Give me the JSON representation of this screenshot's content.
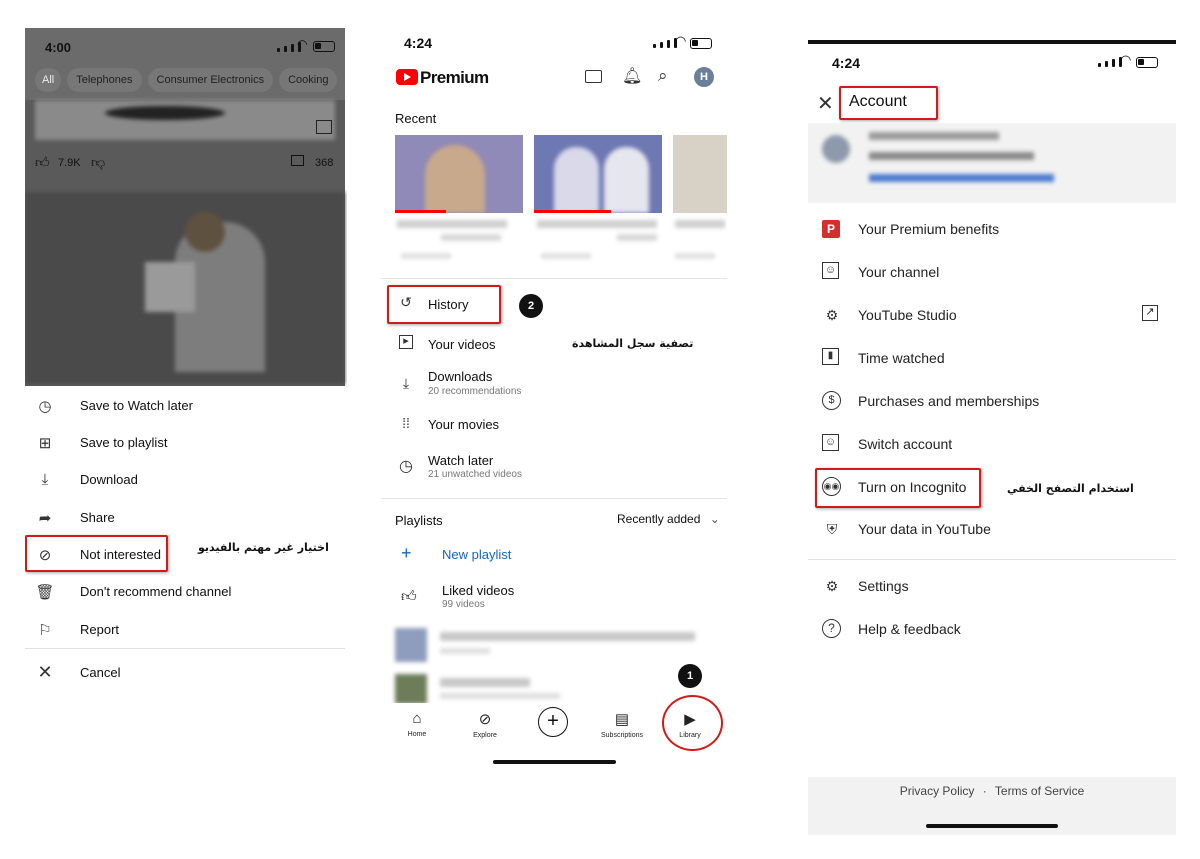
{
  "panel1": {
    "status_time": "4:00",
    "chips": [
      "All",
      "Telephones",
      "Consumer Electronics",
      "Cooking"
    ],
    "likes": "7.9K",
    "comments": "368",
    "menu": [
      {
        "label": "Save to Watch later",
        "icon": "clock-icon"
      },
      {
        "label": "Save to playlist",
        "icon": "playlist-add-icon"
      },
      {
        "label": "Download",
        "icon": "download-icon"
      },
      {
        "label": "Share",
        "icon": "share-icon"
      },
      {
        "label": "Not interested",
        "icon": "not-interested-icon"
      },
      {
        "label": "Don't recommend channel",
        "icon": "trash-icon"
      },
      {
        "label": "Report",
        "icon": "flag-icon"
      }
    ],
    "cancel": "Cancel",
    "annotation": "اختيار غير مهتم بالفيديو"
  },
  "panel2": {
    "status_time": "4:24",
    "brand": "Premium",
    "avatar": "H",
    "recent_heading": "Recent",
    "items": [
      {
        "label": "History",
        "sub": "",
        "icon": "history-icon"
      },
      {
        "label": "Your videos",
        "sub": "",
        "icon": "play-icon"
      },
      {
        "label": "Downloads",
        "sub": "20 recommendations",
        "icon": "download-icon"
      },
      {
        "label": "Your movies",
        "sub": "",
        "icon": "film-icon"
      },
      {
        "label": "Watch later",
        "sub": "21 unwatched videos",
        "icon": "clock-icon"
      }
    ],
    "playlists_heading": "Playlists",
    "sort_label": "Recently added",
    "new_playlist": "New playlist",
    "liked": {
      "label": "Liked videos",
      "sub": "99 videos"
    },
    "nav": [
      "Home",
      "Explore",
      "Subscriptions",
      "Library"
    ],
    "marker1": "1",
    "marker2": "2",
    "annotation": "تصفية سجل المشاهدة"
  },
  "panel3": {
    "status_time": "4:24",
    "title": "Account",
    "items": [
      {
        "label": "Your Premium benefits",
        "icon": "premium-icon"
      },
      {
        "label": "Your channel",
        "icon": "channel-icon"
      },
      {
        "label": "YouTube Studio",
        "icon": "studio-icon"
      },
      {
        "label": "Time watched",
        "icon": "chart-icon"
      },
      {
        "label": "Purchases and memberships",
        "icon": "dollar-icon"
      },
      {
        "label": "Switch account",
        "icon": "switch-account-icon"
      },
      {
        "label": "Turn on Incognito",
        "icon": "incognito-icon"
      },
      {
        "label": "Your data in YouTube",
        "icon": "shield-person-icon"
      },
      {
        "label": "Settings",
        "icon": "gear-icon"
      },
      {
        "label": "Help & feedback",
        "icon": "help-icon"
      }
    ],
    "privacy": "Privacy Policy",
    "separator": "·",
    "terms": "Terms of Service",
    "annotation": "استخدام التصفح الخفي"
  }
}
